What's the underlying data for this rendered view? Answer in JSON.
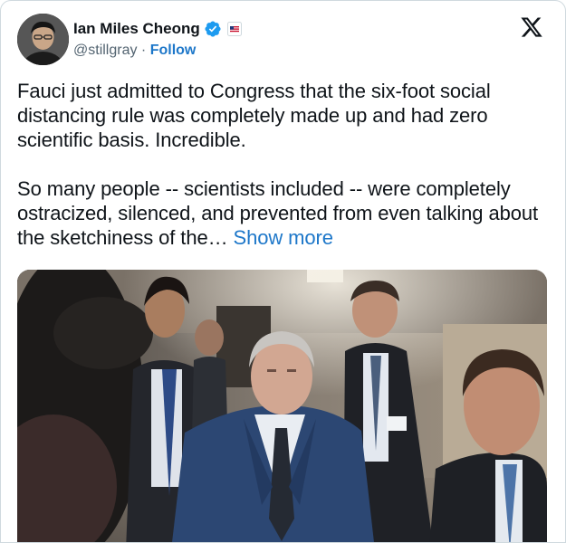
{
  "author": {
    "display_name": "Ian Miles Cheong",
    "handle": "@stillgray",
    "separator": " · ",
    "follow_label": "Follow",
    "avatar_icon": "avatar-photo",
    "verified_icon": "verified-badge-icon",
    "verified_color": "#1d9bf0",
    "affiliate_icon": "affiliate-flag-icon"
  },
  "platform": {
    "logo_icon": "x-logo-icon"
  },
  "tweet": {
    "paragraph_1": "Fauci just admitted to Congress that the six-foot social distancing rule was completely made up and had zero scientific basis. Incredible.",
    "paragraph_2": "So many people -- scientists included -- were completely ostracized, silenced, and prevented from even talking about the sketchiness of the…",
    "show_more_label": "Show more",
    "link_color": "#1d77c9"
  },
  "media": {
    "type": "photo",
    "icon": "photo-image"
  }
}
